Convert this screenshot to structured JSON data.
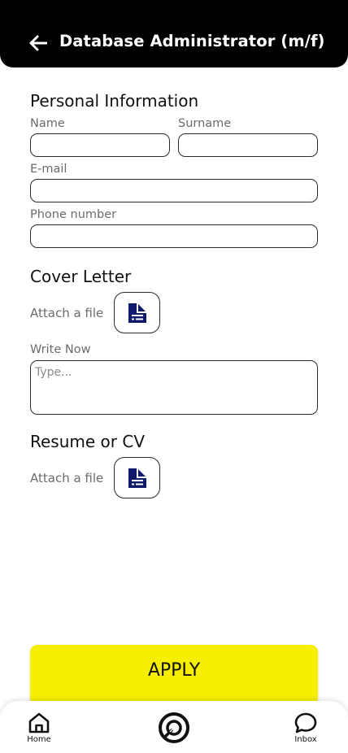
{
  "header": {
    "title": "Database Administrator (m/f)",
    "back_icon": "arrow-left-icon"
  },
  "personal": {
    "section_title": "Personal Information",
    "name_label": "Name",
    "surname_label": "Surname",
    "email_label": "E-mail",
    "phone_label": "Phone number",
    "name_value": "",
    "surname_value": "",
    "email_value": "",
    "phone_value": ""
  },
  "cover_letter": {
    "section_title": "Cover Letter",
    "attach_label": "Attach a file",
    "attach_icon": "document-icon",
    "write_label": "Write Now",
    "write_placeholder": "Type..."
  },
  "resume": {
    "section_title": "Resume or CV",
    "attach_label": "Attach a file",
    "attach_icon": "document-icon"
  },
  "apply_label": "APPLY",
  "nav": {
    "home_label": "Home",
    "inbox_label": "Inbox",
    "center_icon": "target-logo-icon"
  },
  "colors": {
    "header_bg": "#000000",
    "accent_yellow": "#f7ef00",
    "icon_navy": "#0f1a6b"
  }
}
